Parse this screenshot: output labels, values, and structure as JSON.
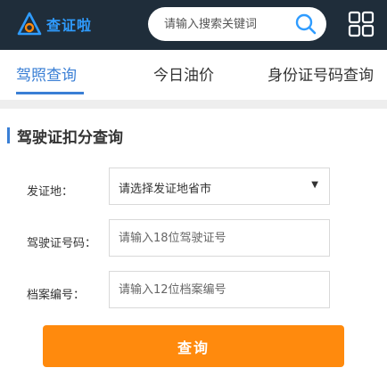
{
  "header": {
    "logo_text": "查证啦",
    "search_placeholder": "请输入搜索关键词"
  },
  "tabs": [
    {
      "label": "驾照查询",
      "active": true
    },
    {
      "label": "今日油价",
      "active": false
    },
    {
      "label": "身份证号码查询",
      "active": false
    }
  ],
  "section": {
    "title": "驾驶证扣分查询"
  },
  "form": {
    "issue_place_label": "发证地：",
    "issue_place_value": "请选择发证地省市",
    "license_label": "驾驶证号码：",
    "license_placeholder": "请输入18位驾驶证号",
    "file_label": "档案编号：",
    "file_placeholder": "请输入12位档案编号",
    "submit_label": "查询"
  },
  "colors": {
    "header_bg": "#1f2d3a",
    "accent": "#3a7fd5",
    "button": "#ff8a0d"
  }
}
